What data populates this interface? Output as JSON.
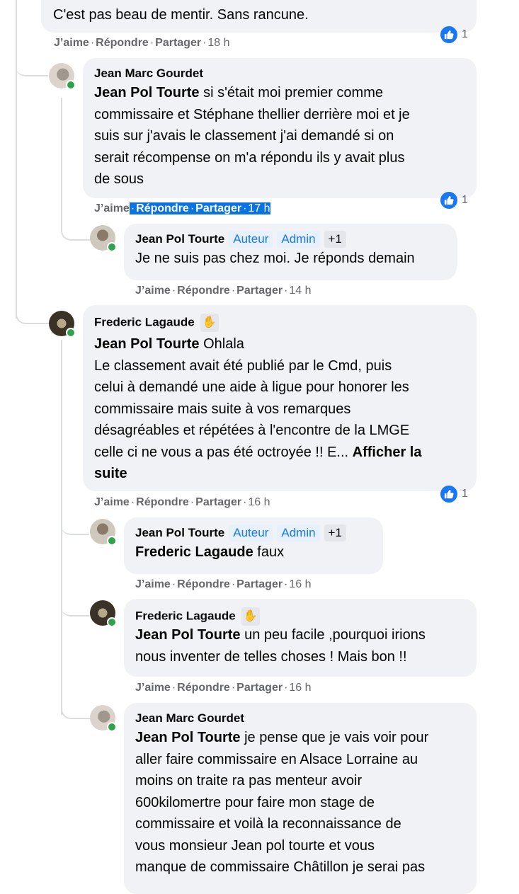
{
  "top": {
    "text": "C'est pas beau de mentir. Sans rancune.",
    "like": "J’aime",
    "reply": "Répondre",
    "share": "Partager",
    "time": "18 h",
    "reactions": "1"
  },
  "c1": {
    "author": "Jean Marc Gourdet",
    "mention": "Jean Pol Tourte",
    "lines": [
      "si s'était moi premier comme",
      "commissaire et Stéphane thellier derrière moi et je",
      "suis sur j'avais le classement j'ai demandé si on",
      "serait récompense on m'a répondu ils y avait plus",
      "de sous"
    ],
    "like": "J’aime",
    "reply": "Répondre",
    "share": "Partager",
    "time": "17 h",
    "reactions": "1"
  },
  "r1": {
    "author": "Jean Pol Tourte",
    "badge1": "Auteur",
    "badge2": "Admin",
    "badge3": "+1",
    "text": "Je ne suis pas chez moi. Je réponds demain",
    "like": "J’aime",
    "reply": "Répondre",
    "share": "Partager",
    "time": "14 h"
  },
  "c2": {
    "author": "Frederic Lagaude",
    "mention": "Jean Pol Tourte",
    "first": "Ohlala",
    "lines": [
      "Le classement avait été publié par le Cmd, puis",
      "celui à demandé une aide à ligue pour honorer les",
      "commissaire mais suite à vos remarques",
      "désagréables et répétées à l'encontre de la LMGE",
      "celle ci ne vous a pas été octroyée !! E..."
    ],
    "more": "Afficher la",
    "more2": "suite",
    "like": "J’aime",
    "reply": "Répondre",
    "share": "Partager",
    "time": "16 h",
    "reactions": "1"
  },
  "r2": {
    "author": "Jean Pol Tourte",
    "badge1": "Auteur",
    "badge2": "Admin",
    "badge3": "+1",
    "mention": "Frederic Lagaude",
    "text": "faux",
    "like": "J’aime",
    "reply": "Répondre",
    "share": "Partager",
    "time": "16 h"
  },
  "r3": {
    "author": "Frederic Lagaude",
    "mention": "Jean Pol Tourte",
    "line1": "un peu facile ,pourquoi irions",
    "line2": "nous inventer de telles choses ! Mais bon !!",
    "like": "J’aime",
    "reply": "Répondre",
    "share": "Partager",
    "time": "16 h"
  },
  "r4": {
    "author": "Jean Marc Gourdet",
    "mention": "Jean Pol Tourte",
    "first": "je pense que je vais voir pour",
    "lines": [
      "aller faire commissaire en Alsace Lorraine au",
      "moins on traite ra pas menteur avoir",
      "600kilomertre pour faire mon stage de",
      "commissaire et voilà la reconnaissance de",
      "vous monsieur Jean pol tourte et vous",
      "manque de commissaire Châtillon je serai pas"
    ]
  },
  "colors": {
    "like_blue": "#1877f2",
    "bubble": "#f0f2f5",
    "meta": "#65676b",
    "highlight": "#0b73e0",
    "online": "#31a24c"
  },
  "icons": [
    "like-icon",
    "wave-hand-icon",
    "avatar"
  ]
}
